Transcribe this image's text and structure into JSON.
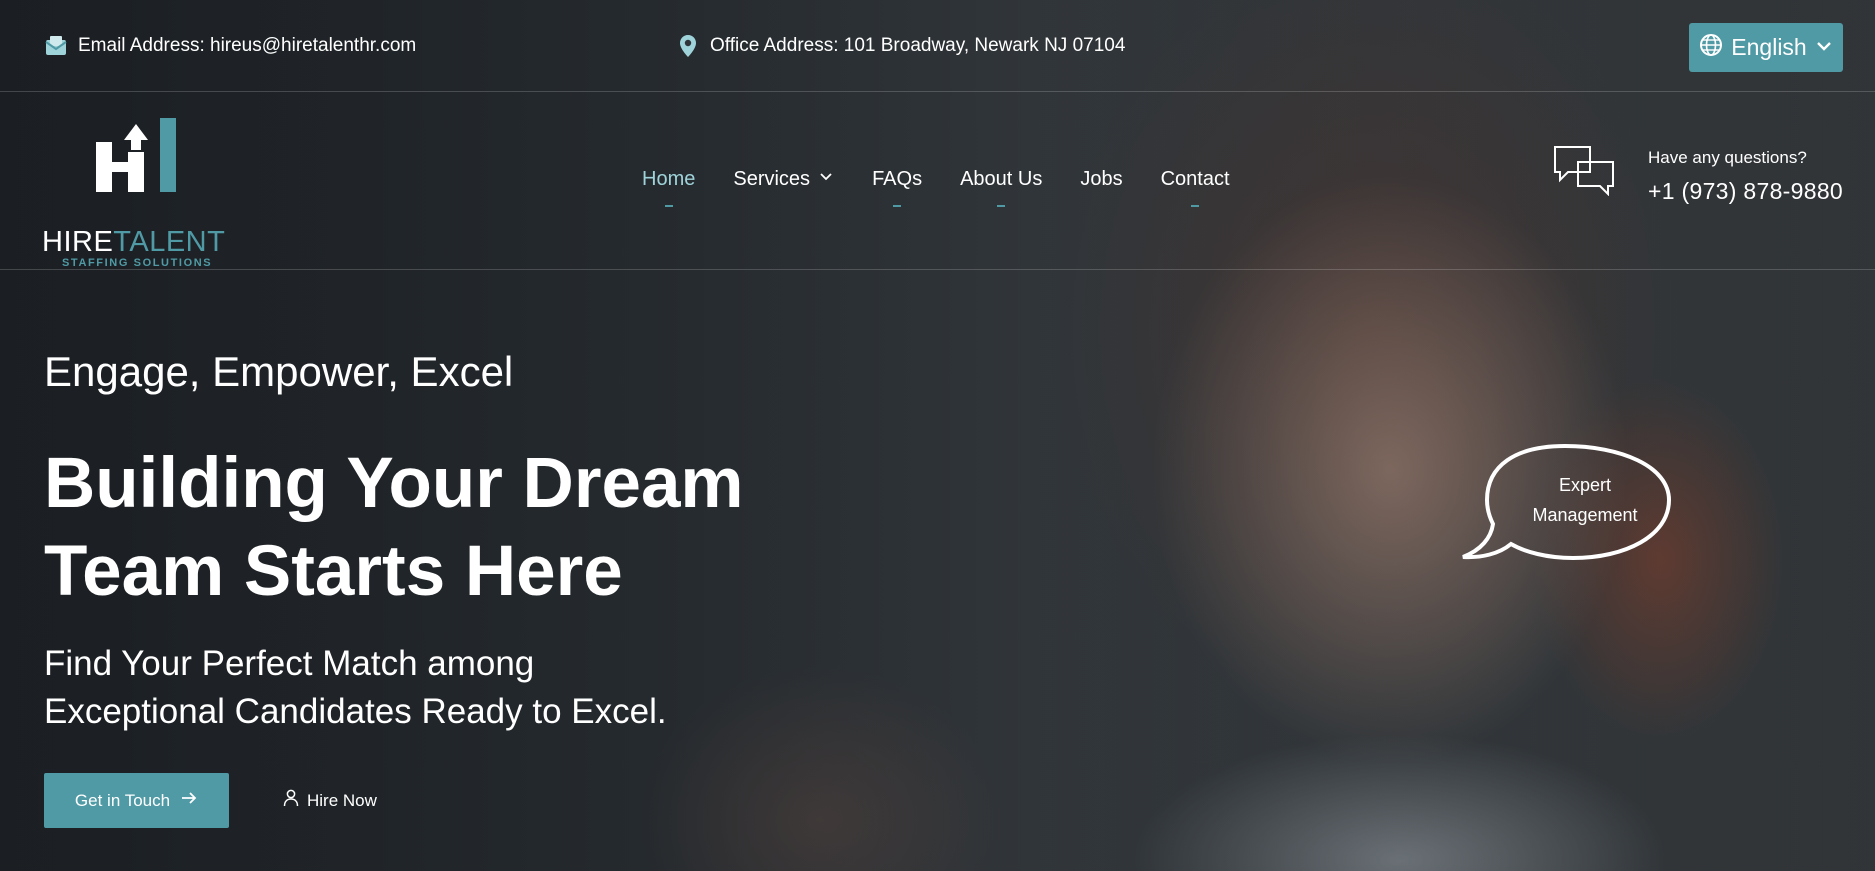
{
  "topbar": {
    "email_label": "Email Address: hireus@hiretalenthr.com",
    "office_label": "Office Address: 101 Broadway, Newark NJ 07104",
    "language": "English",
    "icons": {
      "email": "email-icon",
      "location": "location-pin-icon",
      "globe": "globe-icon",
      "chevron": "chevron-down-icon"
    }
  },
  "logo": {
    "word1": "HIRE",
    "word2": "TALENT",
    "subtitle": "STAFFING SOLUTIONS"
  },
  "nav": {
    "items": [
      {
        "label": "Home",
        "active": true
      },
      {
        "label": "Services",
        "has_dropdown": true
      },
      {
        "label": "FAQs"
      },
      {
        "label": "About Us"
      },
      {
        "label": "Jobs"
      },
      {
        "label": "Contact"
      }
    ]
  },
  "contact": {
    "question": "Have any questions?",
    "phone": "+1 (973) 878-9880",
    "icon": "chat-bubbles-icon"
  },
  "hero": {
    "tagline": "Engage, Empower, Excel",
    "headline_line1": "Building Your Dream",
    "headline_line2": "Team Starts Here",
    "subhead_line1": "Find Your Perfect Match among",
    "subhead_line2": "Exceptional Candidates Ready to Excel.",
    "cta_primary": "Get in Touch",
    "cta_secondary": "Hire Now",
    "bubble_line1": "Expert",
    "bubble_line2": "Management"
  },
  "colors": {
    "accent": "#4f9aa5",
    "nav_active": "#9fd3da",
    "text": "#ffffff"
  }
}
